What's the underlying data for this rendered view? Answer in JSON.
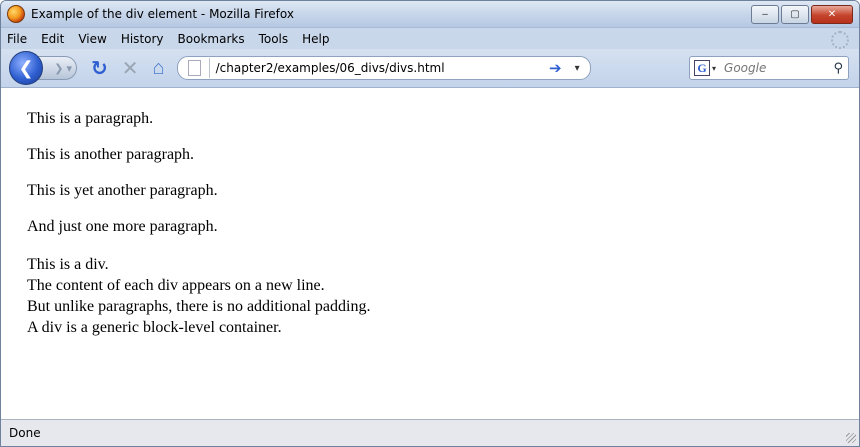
{
  "window": {
    "title": "Example of the div element - Mozilla Firefox",
    "minimize_label": "–",
    "restore_label": "▢",
    "close_label": "✕"
  },
  "menu": {
    "items": [
      "File",
      "Edit",
      "View",
      "History",
      "Bookmarks",
      "Tools",
      "Help"
    ]
  },
  "toolbar": {
    "url": "/chapter2/examples/06_divs/divs.html",
    "search_placeholder": "Google",
    "search_engine_letter": "G"
  },
  "content": {
    "paragraphs": [
      "This is a paragraph.",
      "This is another paragraph.",
      "This is yet another paragraph.",
      "And just one more paragraph."
    ],
    "divs": [
      "This is a div.",
      "The content of each div appears on a new line.",
      "But unlike paragraphs, there is no additional padding.",
      "A div is a generic block-level container."
    ]
  },
  "status": {
    "text": "Done"
  },
  "colors": {
    "titlebar": "#c7d6ea",
    "menubar": "#c9d7eb",
    "accent": "#2f5fd1"
  }
}
